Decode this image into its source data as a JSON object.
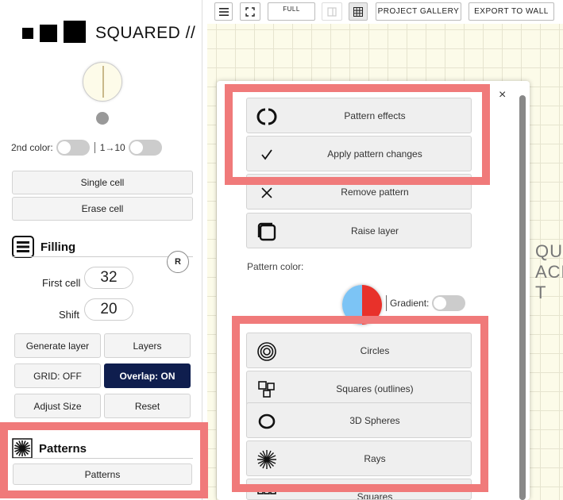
{
  "toolbar": {
    "full_label": "FULL",
    "project_gallery_label": "PROJECT GALLERY",
    "export_label": "EXPORT TO WALL"
  },
  "sidebar": {
    "logo_text": "SQUARED //",
    "second_color_label": "2nd color:",
    "range_label": "1→10",
    "single_cell_label": "Single cell",
    "erase_cell_label": "Erase cell",
    "filling_title": "Filling",
    "reset_icon_label": "R",
    "first_cell_label": "First cell",
    "first_cell_value": "32",
    "shift_label": "Shift",
    "shift_value": "20",
    "generate_layer_label": "Generate layer",
    "layers_label": "Layers",
    "grid_label": "GRID: OFF",
    "overlap_label": "Overlap: ON",
    "adjust_size_label": "Adjust Size",
    "reset_label": "Reset",
    "patterns_title": "Patterns",
    "patterns_button_label": "Patterns"
  },
  "canvas": {
    "bg_text_lines": [
      "QUAI",
      "ACE",
      "T"
    ]
  },
  "modal": {
    "close_label": "×",
    "options": [
      {
        "label": "Pattern effects",
        "icon": "pattern-effects-icon"
      },
      {
        "label": "Apply pattern changes",
        "icon": "checkmark-icon"
      },
      {
        "label": "Remove pattern",
        "icon": "remove-x-icon"
      },
      {
        "label": "Raise layer",
        "icon": "raise-layer-icon"
      }
    ],
    "pattern_color_label": "Pattern color:",
    "gradient_label": "Gradient:",
    "patterns": [
      {
        "label": "Circles",
        "icon": "circles-icon"
      },
      {
        "label": "Squares (outlines)",
        "icon": "squares-outlines-icon"
      },
      {
        "label": "3D Spheres",
        "icon": "spheres-icon"
      },
      {
        "label": "Rays",
        "icon": "rays-icon"
      },
      {
        "label": "Squares",
        "icon": "squares-icon"
      }
    ],
    "colors": {
      "left": "#7cc4f5",
      "right": "#e8312a"
    }
  },
  "colors": {
    "highlight": "#f07a7a",
    "overlap_button": "#0f1e4e"
  }
}
